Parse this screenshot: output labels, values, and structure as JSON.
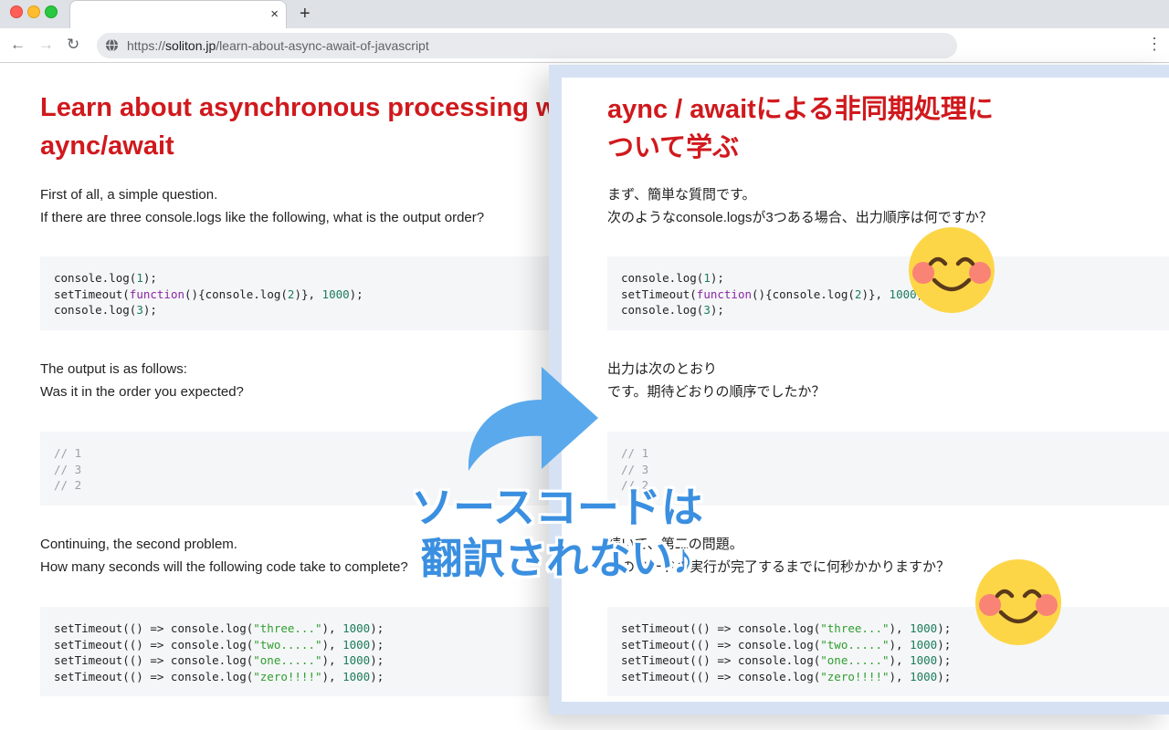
{
  "browser": {
    "url_scheme": "https://",
    "url_host": "soliton.jp",
    "url_path": "/learn-about-async-await-of-javascript",
    "close_tab": "×",
    "new_tab": "+",
    "back": "←",
    "forward": "→",
    "reload": "↻",
    "menu": "⋮"
  },
  "original": {
    "title_line1": "Learn about asynchronous processing with",
    "title_line2": "aync/await",
    "intro_line1": "First of all, a simple question.",
    "intro_line2": "If there are three console.logs like the following, what is the output order?",
    "output_line1": "The output is as follows:",
    "output_line2": "Was it in the order you expected?",
    "second_line1": "Continuing, the second problem.",
    "second_line2": "How many seconds will the following code take to complete?",
    "code1": {
      "l1a": "console.log(",
      "l1n": "1",
      "l1b": ");",
      "l2a": "setTimeout(",
      "l2kw": "function",
      "l2b": "(){console.log(",
      "l2n1": "2",
      "l2c": ")}, ",
      "l2n2": "1000",
      "l2d": ");",
      "l3a": "console.log(",
      "l3n": "3",
      "l3b": ");"
    },
    "code2": [
      "// 1",
      "// 3",
      "// 2"
    ],
    "code3": [
      {
        "pre": "setTimeout(() => console.log(",
        "str": "\"three...\"",
        "mid": "), ",
        "num": "1000",
        "post": ");"
      },
      {
        "pre": "setTimeout(() => console.log(",
        "str": "\"two.....\"",
        "mid": "), ",
        "num": "1000",
        "post": ");"
      },
      {
        "pre": "setTimeout(() => console.log(",
        "str": "\"one.....\"",
        "mid": "), ",
        "num": "1000",
        "post": ");"
      },
      {
        "pre": "setTimeout(() => console.log(",
        "str": "\"zero!!!!\"",
        "mid": "), ",
        "num": "1000",
        "post": ");"
      }
    ]
  },
  "translated": {
    "title_line1": "aync / awaitによる非同期処理に",
    "title_line2": "ついて学ぶ",
    "intro_line1": "まず、簡単な質問です。",
    "intro_line2": "次のようなconsole.logsが3つある場合、出力順序は何ですか？",
    "output_line1": "出力は次のとおり",
    "output_line2": "です。期待どおりの順序でしたか？",
    "second_line1": "続いて、第二の問題。",
    "second_line2": "次のコードの実行が完了するまでに何秒かかりますか？"
  },
  "caption": {
    "line1": "ソースコードは",
    "line2": "翻訳されない♪"
  },
  "colors": {
    "title_red": "#d0191d",
    "caption_blue": "#3a8fe0",
    "arrow_blue": "#5aa9ec",
    "overlay_frame": "#d6e2f4"
  },
  "icons": {
    "arrow": "curved-arrow-right-icon",
    "emoji": "smiling-face-icon",
    "site": "globe-icon"
  }
}
